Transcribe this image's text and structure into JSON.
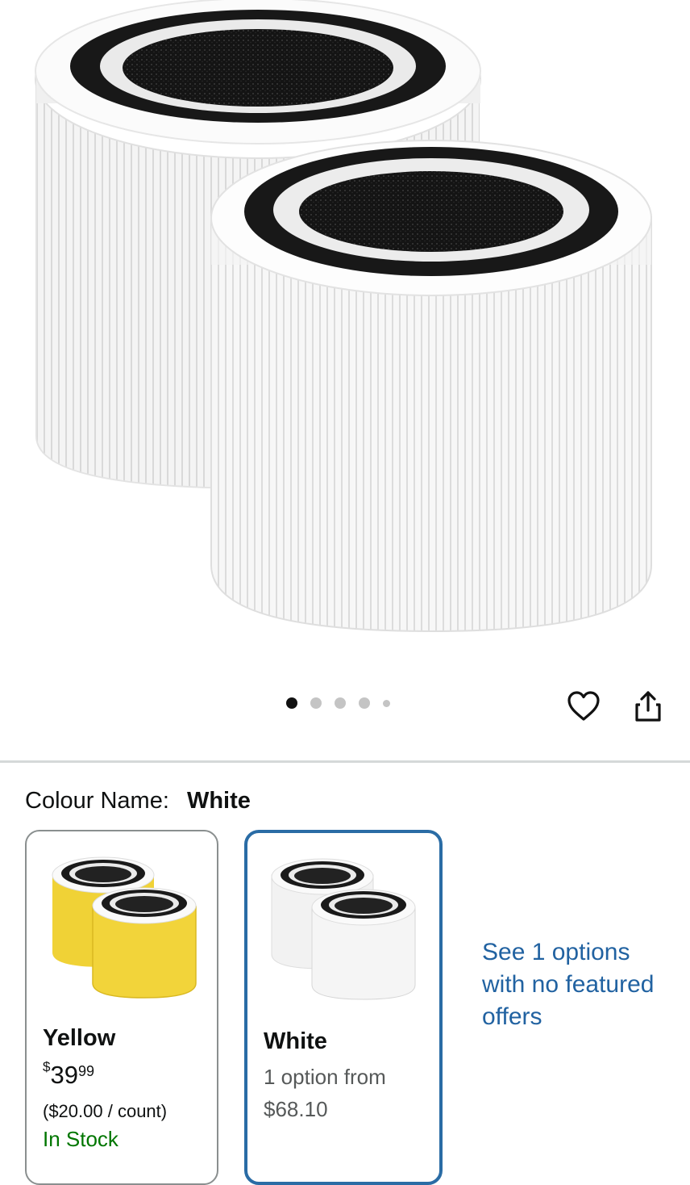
{
  "gallery": {
    "image_alt": "Two white cylindrical air purifier filters",
    "dots": [
      true,
      false,
      false,
      false,
      false
    ],
    "wishlist_icon": "heart-icon",
    "share_icon": "share-icon"
  },
  "variation": {
    "label": "Colour Name:",
    "selected": "White"
  },
  "swatches": [
    {
      "name": "Yellow",
      "currency": "$",
      "price_whole": "39",
      "price_fraction": "99",
      "unit_price": "($20.00 / count)",
      "availability": "In Stock",
      "filter_color": "#f2d43a"
    },
    {
      "name": "White",
      "option_line": "1 option from",
      "option_price": "$68.10",
      "filter_color": "#f2f2f2"
    }
  ],
  "offers_link": "See 1 options with no featured offers",
  "colors": {
    "accent_link": "#2162a1",
    "selected_border": "#2a6ca5",
    "in_stock": "#007600"
  }
}
